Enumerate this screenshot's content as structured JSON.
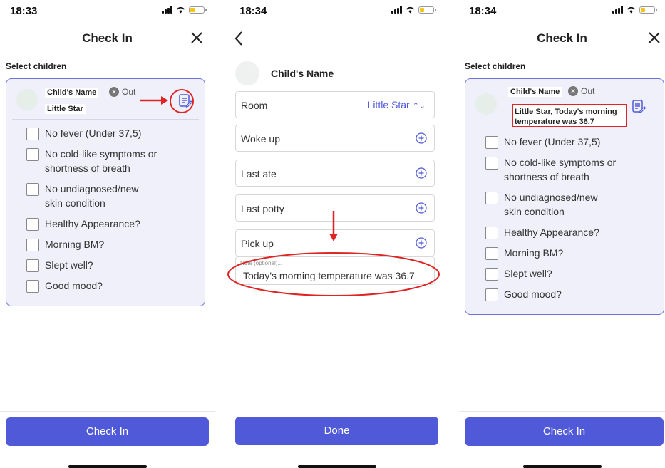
{
  "panel1": {
    "time": "18:33",
    "title": "Check In",
    "section_label": "Select children",
    "child_name": "Child's Name",
    "status": "Out",
    "room": "Little Star",
    "checklist": [
      "No fever (Under 37,5)",
      "No cold-like symptoms or shortness of breath",
      "No undiagnosed/new skin condition",
      "Healthy Appearance?",
      "Morning BM?",
      "Slept well?",
      "Good mood?"
    ],
    "button": "Check In"
  },
  "panel2": {
    "time": "18:34",
    "child_name": "Child's Name",
    "room_label": "Room",
    "room_value": "Little Star",
    "fields": [
      "Woke up",
      "Last ate",
      "Last potty",
      "Pick up"
    ],
    "note_placeholder": "Note (optional)...",
    "note_value": "Today's morning temperature was 36.7",
    "button": "Done"
  },
  "panel3": {
    "time": "18:34",
    "title": "Check In",
    "section_label": "Select children",
    "child_name": "Child's Name",
    "status": "Out",
    "room_note": "Little Star, Today's morning temperature was 36.7",
    "checklist": [
      "No fever (Under 37,5)",
      "No cold-like symptoms or shortness of breath",
      "No undiagnosed/new skin condition",
      "Healthy Appearance?",
      "Morning BM?",
      "Slept well?",
      "Good mood?"
    ],
    "button": "Check In"
  },
  "colors": {
    "accent": "#5059d8",
    "card_border": "#6b72db",
    "card_bg": "#f0f0fb",
    "annotation": "#e02424"
  }
}
